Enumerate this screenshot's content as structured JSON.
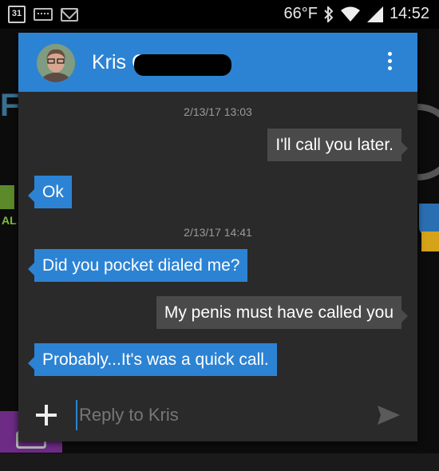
{
  "status_bar": {
    "calendar_day": "31",
    "temperature": "66°F",
    "time": "14:52",
    "icons": [
      "calendar-icon",
      "keyboard-icon",
      "gmail-icon",
      "bluetooth-icon",
      "wifi-icon",
      "signal-icon"
    ]
  },
  "conversation": {
    "contact_name": "Kris C",
    "menu_icon": "overflow-menu-icon",
    "messages": [
      {
        "type": "timestamp",
        "text": "2/13/17 13:03"
      },
      {
        "type": "outgoing",
        "text": "I'll call you later."
      },
      {
        "type": "incoming",
        "text": "Ok"
      },
      {
        "type": "timestamp",
        "text": "2/13/17 14:41"
      },
      {
        "type": "incoming",
        "text": "Did you pocket dialed me?"
      },
      {
        "type": "outgoing",
        "text": "My penis must have called you"
      },
      {
        "type": "incoming",
        "text": "Probably...It's was a quick call."
      }
    ]
  },
  "composer": {
    "placeholder": "Reply to Kris",
    "attach_icon": "plus-icon",
    "send_icon": "send-icon"
  },
  "background": {
    "left_letters": "FNOW",
    "left_label": "AL"
  },
  "colors": {
    "accent_blue": "#2c83d4",
    "dialog_bg": "#2a2a2a",
    "outgoing_bubble": "#4a4a4a"
  }
}
